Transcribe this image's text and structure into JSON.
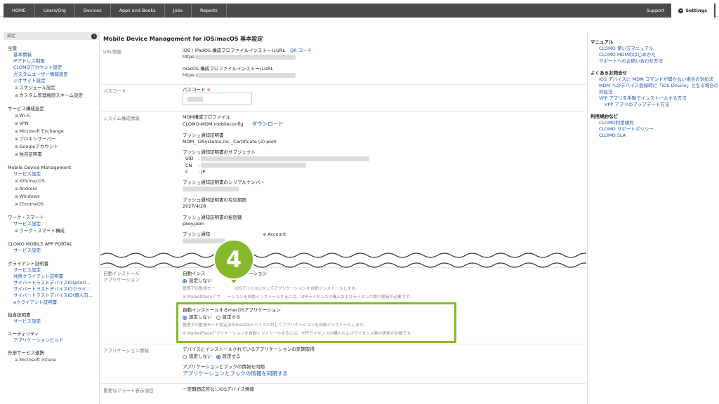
{
  "nav": {
    "items": [
      "HOME",
      "Users/Org",
      "Devices",
      "Apps and Books",
      "Jobs",
      "Reports"
    ],
    "support": "Support",
    "settings": "Settings"
  },
  "sidebar": {
    "header": "設定",
    "groups": [
      {
        "title": "全般",
        "links": [
          "基本情報",
          "IPアドレス制限",
          "CLOMOアカウント設定",
          "カスタムユーザー情報設定",
          "ジオサイト設定"
        ],
        "subs": [
          "スケジュール設定",
          "カスタム管理権限スキーム設定"
        ]
      },
      {
        "title": "サービス構成設定",
        "links": [],
        "subs": [
          "Wi-Fi",
          "VPN",
          "Microsoft Exchange",
          "プロキシサーバー",
          "Googleアカウント",
          "独自証明書"
        ]
      },
      {
        "title": "Mobile Device Management",
        "links": [
          "サービス設定"
        ],
        "subs": [
          "iOS/macOS",
          "Android",
          "Windows",
          "ChromeOS"
        ]
      },
      {
        "title": "ワーク・スマート",
        "links": [
          "サービス設定"
        ],
        "subs": [
          "ワーク・スマート構成"
        ]
      },
      {
        "title": "CLOMO MOBILE APP PORTAL",
        "links": [
          "サービス設定"
        ],
        "subs": []
      },
      {
        "title": "クライアント証明書",
        "links": [
          "サービス設定",
          "共用クライアント証明書",
          "サイバートラストデバイスID(pilot)...",
          "サイバートラストデバイスIDクライ...",
          "サイバートラストデバイスID(個人向...",
          "aクライアント証明書"
        ],
        "subs": []
      },
      {
        "title": "独自証明書",
        "links": [
          "サービス設定"
        ],
        "subs": []
      },
      {
        "title": "ユーティリティ",
        "links": [
          "アプリケーションビルド"
        ],
        "subs": []
      },
      {
        "title": "外部サービス連携",
        "links": [],
        "subs": [
          "Microsoft Intune"
        ]
      }
    ]
  },
  "main": {
    "title": "Mobile Device Management for iOS/macOS 基本設定",
    "url_label": "URL情報",
    "ios_url_title": "iOS / iPadOS 構成プロファイルインストールURL",
    "qr_code": "QR コード",
    "https1": "https:/",
    "mac_url_title": "macOS 構成プロファイルインストールURL",
    "https2": "https:/",
    "passcode_label": "パスコード",
    "passcode_title": "パスコード",
    "req_mark": "※",
    "sys_label": "システム構成情報",
    "mdm_profile_title": "MDM構成プロファイル",
    "mdm_profile_file": "CLOMO-MDM.mobileconfig",
    "download": "ダウンロード",
    "push_cert_title": "プッシュ通知証明書",
    "push_cert_file": "MDM_ i3Systems,Inc._Certificate (2).pem",
    "push_subject_title": "プッシュ通知証明書のサブジェクト",
    "uid": "UID",
    "cn": "CN",
    "c": "C",
    "colon": ":",
    "c_val": "JP",
    "push_serial_title": "プッシュ通知証明書のシリアルナンバー",
    "push_expiry_title": "プッシュ通知証明書の有効期限",
    "push_expiry_val": "2027/4/28",
    "push_key_title": "プッシュ通知証明書の秘密鍵",
    "push_key_val": "pkey.pem",
    "push_account_title_a": "プッシュ通知",
    "push_account_title_b": "e Account",
    "auto_label_1": "自動インストール",
    "auto_label_2": "アプリケーション",
    "auto_ios_a": "自動インス",
    "auto_ios_b": "ーション",
    "not_set": "設定しない",
    "set": "設定する",
    "auto_ios_note_a": "管理下の監視モー",
    "auto_ios_note_b": "iOSデバイスに対してアプリケーションを自動インストールします。",
    "auto_ios_note2_a": "※ MarketPlaceアプ",
    "auto_ios_note2_b": "ーションを自動インストールするには、VPPライセンスの購入およびライセンス数の更新が必要です。",
    "auto_mac_title": "自動インストールするmacOSアプリケーション",
    "auto_mac_note": "管理下の監視モード設定済のmacOSデバイスに対してアプリケーションを自動インストールします。",
    "auto_mac_note2": "※ MarketPlaceアプリケーションを自動インストールするには、VPPライセンスの購入およびライセンス数の更新が必要です。",
    "app_info_label": "アプリケーション情報",
    "periodic_title": "デバイスにインストールされているアプリケーションの定期取得",
    "sync_title": "アプリケーションとブックの情報を同期",
    "sync_link": "アプリケーションとブックの情報を同期する",
    "alert_label": "重要なアラート表示項目",
    "alert_val": "一定期間応答なしiOSデバイス情報",
    "step_badge": "4"
  },
  "right": {
    "manual_title": "マニュアル",
    "manual_links": [
      "CLOMO 使い方マニュアル",
      "CLOMO MDMのはじめかた",
      "サポートへのお問い合わせ方法"
    ],
    "faq_title": "よくあるお問合せ",
    "faq_links": [
      "iOS デバイスに MDM コマンドが届かない場合の対処法",
      "MDM へのデバイス登録時に「iOS Device」となる場合の対処法",
      "VPP アプリを手動でインストールする方法"
    ],
    "faq_sub": "VPP アプリのアップデート方法",
    "terms_title": "利用規約など",
    "terms_links": [
      "CLOMO利用規約",
      "CLOMO サポートポリシー",
      "CLOMO SLA"
    ]
  }
}
